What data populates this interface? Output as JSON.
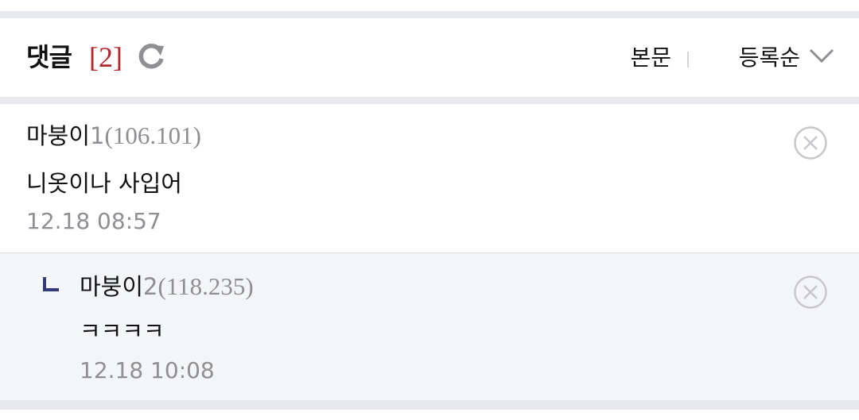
{
  "header": {
    "title": "댓글",
    "count": "[2]",
    "refresh_icon": "refresh-icon",
    "sort": {
      "body_label": "본문",
      "order_label": "등록순",
      "chevron_icon": "chevron-down-icon"
    }
  },
  "comments": [
    {
      "name": "마붕이",
      "num": "1",
      "ip": "(106.101)",
      "text": "니옷이나 사입어",
      "date": "12.18 08:57",
      "delete_icon": "close-circle-icon"
    }
  ],
  "replies": [
    {
      "reply_icon": "reply-arrow-icon",
      "name": "마붕이",
      "num": "2",
      "ip": "(118.235)",
      "text": "ㅋㅋㅋㅋ",
      "date": "12.18 10:08",
      "delete_icon": "close-circle-icon"
    }
  ],
  "colors": {
    "accent_count": "#b3262b",
    "muted_text": "#8e8e93",
    "reply_background": "#f4f5f8",
    "reply_mark": "#323a7a",
    "separator": "#e8e9ee"
  }
}
